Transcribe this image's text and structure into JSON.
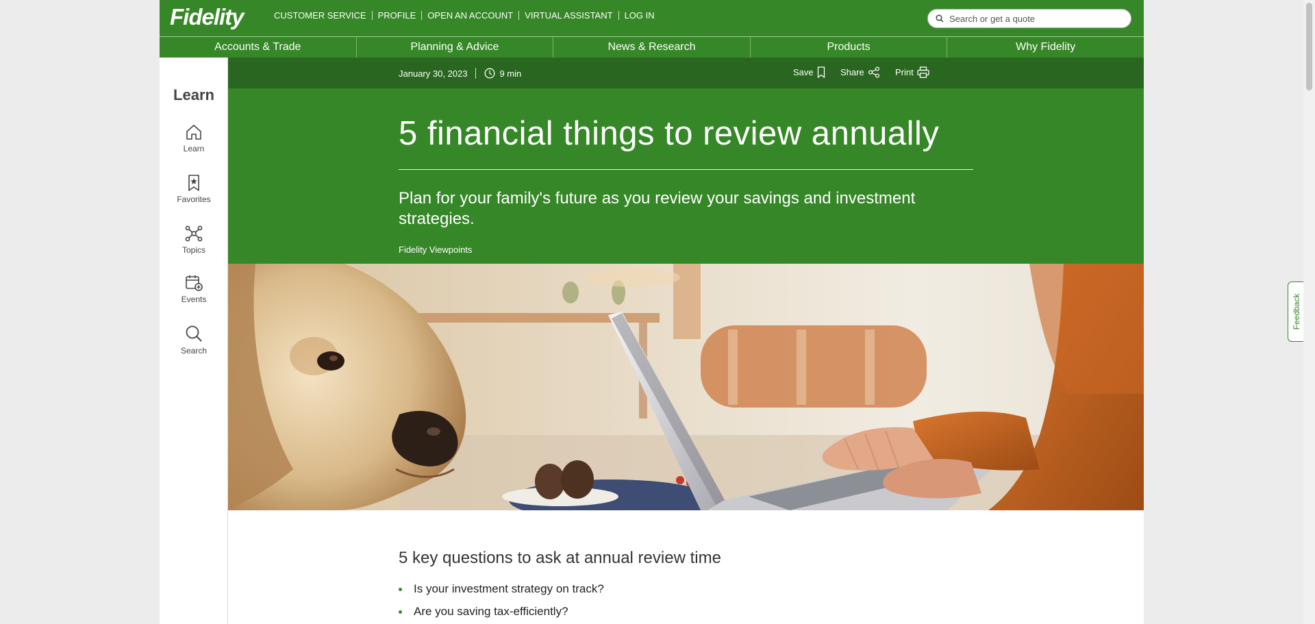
{
  "brand": {
    "logo_text": "Fidelity",
    "accent": "#368727",
    "dark_accent": "#29661f"
  },
  "top_links": [
    "CUSTOMER SERVICE",
    "PROFILE",
    "OPEN AN ACCOUNT",
    "VIRTUAL ASSISTANT",
    "LOG IN"
  ],
  "search": {
    "placeholder": "Search or get a quote",
    "icon": "search-icon"
  },
  "main_nav": [
    "Accounts & Trade",
    "Planning & Advice",
    "News & Research",
    "Products",
    "Why Fidelity"
  ],
  "sidebar": {
    "title": "Learn",
    "items": [
      {
        "label": "Learn",
        "icon": "home-icon"
      },
      {
        "label": "Favorites",
        "icon": "bookmark-star-icon"
      },
      {
        "label": "Topics",
        "icon": "network-icon"
      },
      {
        "label": "Events",
        "icon": "calendar-plus-icon"
      },
      {
        "label": "Search",
        "icon": "search-icon"
      }
    ]
  },
  "article": {
    "date": "January 30, 2023",
    "read_time": "9 min",
    "actions": {
      "save": "Save",
      "share": "Share",
      "print": "Print"
    },
    "title": "5 financial things to review annually",
    "subtitle": "Plan for your family's future as you review your savings and investment strategies.",
    "byline": "Fidelity Viewpoints",
    "section_heading": "5 key questions to ask at annual review time",
    "questions": [
      "Is your investment strategy on track?",
      "Are you saving tax-efficiently?"
    ]
  },
  "feedback_label": "Feedback"
}
